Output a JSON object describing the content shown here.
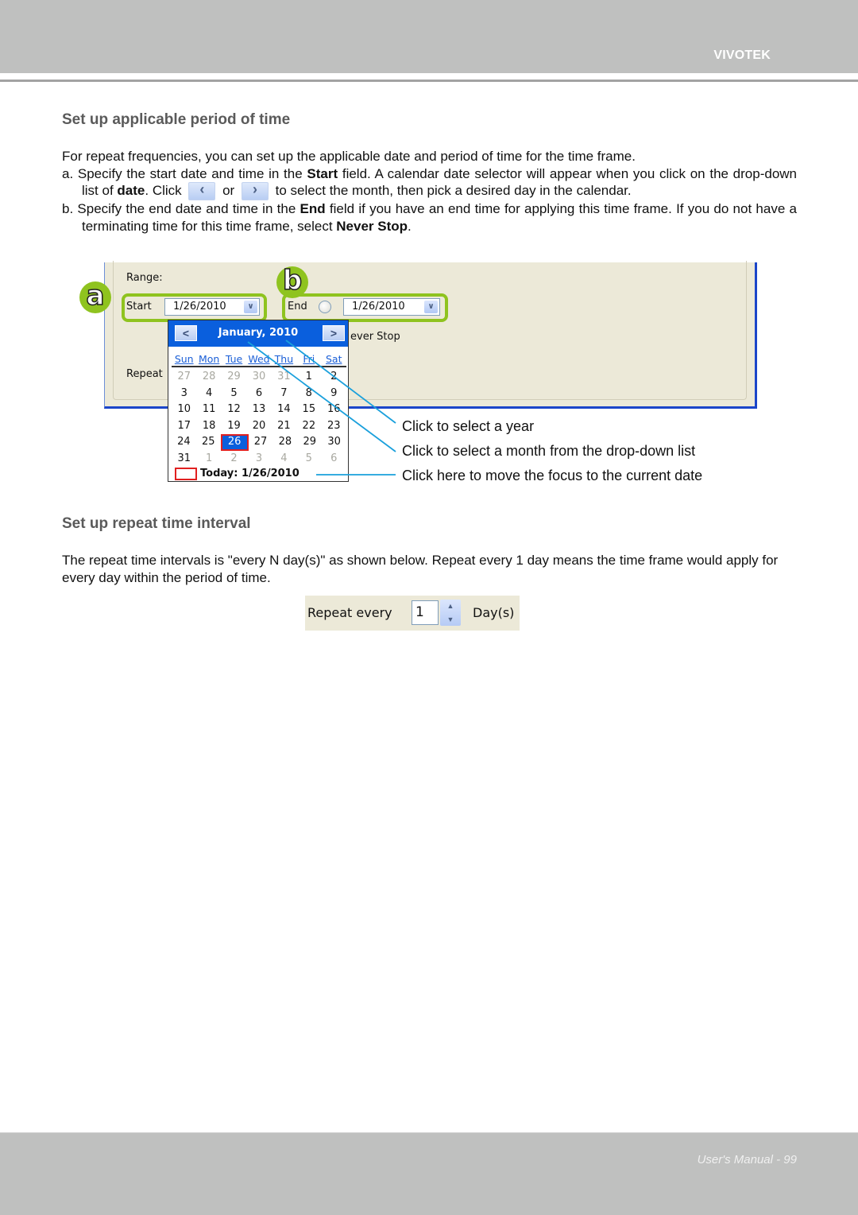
{
  "header": {
    "brand": "VIVOTEK"
  },
  "section1": {
    "heading": "Set up applicable period of time",
    "intro": "For repeat frequencies, you can set up the applicable date and period of time for the time frame.",
    "item_a": {
      "prefix": "a. Specify the start date and time in the ",
      "bold1": "Start",
      "mid1": " field. A calendar date selector will appear when you click on the drop-down list of ",
      "bold2": "date",
      "mid2": ". Click ",
      "or": " or ",
      "suffix": " to select the month, then pick a desired day in the calendar.",
      "prev_icon": "chevron-left-icon",
      "next_icon": "chevron-right-icon"
    },
    "item_b": {
      "prefix": "b. Specify the end date and time in the ",
      "bold1": "End",
      "mid1": " field if you have an end time for applying this time frame. If you do not have a terminating time for this time frame, select ",
      "bold2": "Never Stop",
      "suffix": "."
    }
  },
  "dialog": {
    "range_label": "Range:",
    "start_label": "Start",
    "start_value": "1/26/2010",
    "end_label": "End",
    "end_value": "1/26/2010",
    "never_stop_label": "ever Stop",
    "repeat_label": "Repeat",
    "badge_a": "a",
    "badge_b": "b",
    "accent_color": "#8fc31f"
  },
  "calendar": {
    "title": "January, 2010",
    "prev": "<",
    "next": ">",
    "weekdays": [
      "Sun",
      "Mon",
      "Tue",
      "Wed",
      "Thu",
      "Fri",
      "Sat"
    ],
    "weeks": [
      [
        {
          "d": "27",
          "o": true
        },
        {
          "d": "28",
          "o": true
        },
        {
          "d": "29",
          "o": true
        },
        {
          "d": "30",
          "o": true
        },
        {
          "d": "31",
          "o": true
        },
        {
          "d": "1"
        },
        {
          "d": "2"
        }
      ],
      [
        {
          "d": "3"
        },
        {
          "d": "4"
        },
        {
          "d": "5"
        },
        {
          "d": "6"
        },
        {
          "d": "7"
        },
        {
          "d": "8"
        },
        {
          "d": "9"
        }
      ],
      [
        {
          "d": "10"
        },
        {
          "d": "11"
        },
        {
          "d": "12"
        },
        {
          "d": "13"
        },
        {
          "d": "14"
        },
        {
          "d": "15"
        },
        {
          "d": "16"
        }
      ],
      [
        {
          "d": "17"
        },
        {
          "d": "18"
        },
        {
          "d": "19"
        },
        {
          "d": "20"
        },
        {
          "d": "21"
        },
        {
          "d": "22"
        },
        {
          "d": "23"
        }
      ],
      [
        {
          "d": "24"
        },
        {
          "d": "25"
        },
        {
          "d": "26",
          "sel": true
        },
        {
          "d": "27"
        },
        {
          "d": "28"
        },
        {
          "d": "29"
        },
        {
          "d": "30"
        }
      ],
      [
        {
          "d": "31"
        },
        {
          "d": "1",
          "o": true
        },
        {
          "d": "2",
          "o": true
        },
        {
          "d": "3",
          "o": true
        },
        {
          "d": "4",
          "o": true
        },
        {
          "d": "5",
          "o": true
        },
        {
          "d": "6",
          "o": true
        }
      ]
    ],
    "today": "Today: 1/26/2010",
    "header_color": "#0a5fdd"
  },
  "callouts": [
    "Click to select a year",
    "Click to select a month from the drop-down list",
    "Click here to move the focus to the current date"
  ],
  "section2": {
    "heading": "Set up repeat time interval",
    "body": "The repeat time intervals is \"every N day(s)\" as shown below. Repeat every 1 day means the time frame would apply for every day within the period of time."
  },
  "repeat_widget": {
    "label": "Repeat every",
    "value": "1",
    "unit": "Day(s)"
  },
  "footer": {
    "page_label": "User's Manual - 99"
  }
}
